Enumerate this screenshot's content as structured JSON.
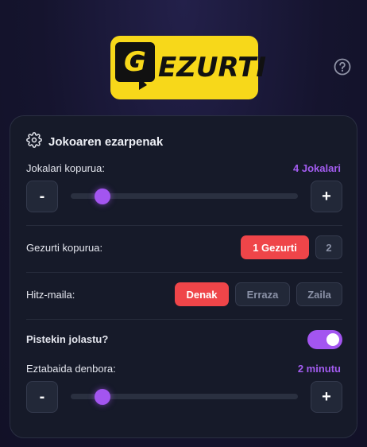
{
  "logo": {
    "letter": "G",
    "text": "EZURTI"
  },
  "help_icon": "question-circle-icon",
  "settings": {
    "title": "Jokoaren ezarpenak",
    "icon": "gear-icon",
    "players": {
      "label": "Jokalari kopurua:",
      "value_text": "4 Jokalari",
      "value": 4,
      "min_label": "-",
      "plus_label": "+",
      "slider_fraction": 0.14
    },
    "liars": {
      "label": "Gezurti kopurua:",
      "options": [
        "1 Gezurti",
        "2"
      ],
      "selected": "1 Gezurti"
    },
    "difficulty": {
      "label": "Hitz-maila:",
      "options": [
        "Denak",
        "Erraza",
        "Zaila"
      ],
      "selected": "Denak"
    },
    "points": {
      "label": "Pistekin jolastu?",
      "enabled": true
    },
    "debate": {
      "label": "Eztabaida denbora:",
      "value_text": "2 minutu",
      "value": 2,
      "min_label": "-",
      "plus_label": "+",
      "slider_fraction": 0.14
    }
  },
  "colors": {
    "accent_purple": "#a355f0",
    "active_red": "#ef4549",
    "logo_yellow": "#f7d81a"
  }
}
